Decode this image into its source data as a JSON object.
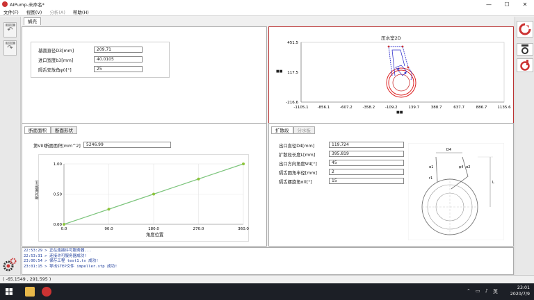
{
  "window": {
    "title": "AIPump-未命名*",
    "minimize": "—",
    "maximize": "☐",
    "close": "✕"
  },
  "menu": [
    {
      "label": "文件(F)",
      "enabled": true
    },
    {
      "label": "视图(V)",
      "enabled": true
    },
    {
      "label": "分析(A)",
      "enabled": false
    },
    {
      "label": "帮助(H)",
      "enabled": true
    }
  ],
  "left_toolbar": {
    "undo": "Undo",
    "redo": "Redo"
  },
  "main_tab": "蜗壳",
  "top_left": {
    "fields": [
      {
        "label": "基圆直径D3[mm]",
        "value": "209.71"
      },
      {
        "label": "进口宽度b3[mm]",
        "value": "40.0105"
      },
      {
        "label": "隔舌安放角φ0[°]",
        "value": "25"
      }
    ]
  },
  "volute_chart": {
    "title": "压水室2D",
    "y_ticks": [
      "451.5",
      "117.5",
      "-216.6"
    ],
    "x_ticks": [
      "-1105.1",
      "-856.1",
      "-607.2",
      "-358.2",
      "-109.2",
      "139.7",
      "388.7",
      "637.7",
      "886.7",
      "1135.6"
    ],
    "y_label": "■■",
    "x_label": "■■"
  },
  "section": {
    "tabs": [
      "断面面积",
      "断面形状"
    ],
    "area_label": "第VIII断面面积[mm^2]",
    "area_value": "5246.99"
  },
  "chart_data": {
    "type": "line",
    "title": "",
    "xlabel": "角度位置",
    "ylabel": "相对面积比",
    "x": [
      0,
      90,
      180,
      270,
      360
    ],
    "values": [
      0.0,
      0.25,
      0.5,
      0.75,
      1.0
    ],
    "xlim": [
      0,
      360
    ],
    "ylim": [
      0,
      1
    ],
    "x_tick_labels": [
      "0.0",
      "90.0",
      "180.0",
      "270.0",
      "360.0"
    ],
    "y_tick_labels": [
      "0.00",
      "0.50",
      "1.00"
    ],
    "line_color": "#7dc57d",
    "marker_color": "#8dc43c",
    "grid": true
  },
  "diffuser": {
    "tabs": [
      "扩散段",
      "分水板"
    ],
    "fields": [
      {
        "label": "出口直径D4[mm]",
        "value": "119.724"
      },
      {
        "label": "扩散段长度L[mm]",
        "value": "395.819"
      },
      {
        "label": "出口方向角度Ψ4[°]",
        "value": "45"
      },
      {
        "label": "隔舌圆角半径[mm]",
        "value": "2"
      },
      {
        "label": "隔舌螺旋角α0[°]",
        "value": "15"
      }
    ],
    "sketch_labels": {
      "d4": "D4",
      "a1": "α1",
      "a2": "α2",
      "psi4": "ψ4",
      "l": "L",
      "r1": "r1"
    }
  },
  "console_log": [
    "22:53:29 > 正在连接许可服务器...",
    "22:53:31 > 连接许可服务器成功!",
    "23:00:54 > 保存工程 test1.tv 成功!",
    "23:01:15 > 导出STEP文件 impeller.stp 成功!"
  ],
  "status": "( -65.1549 , 291.595 )",
  "taskbar": {
    "time": "23:01",
    "date": "2020/7/9",
    "ime": "英"
  }
}
